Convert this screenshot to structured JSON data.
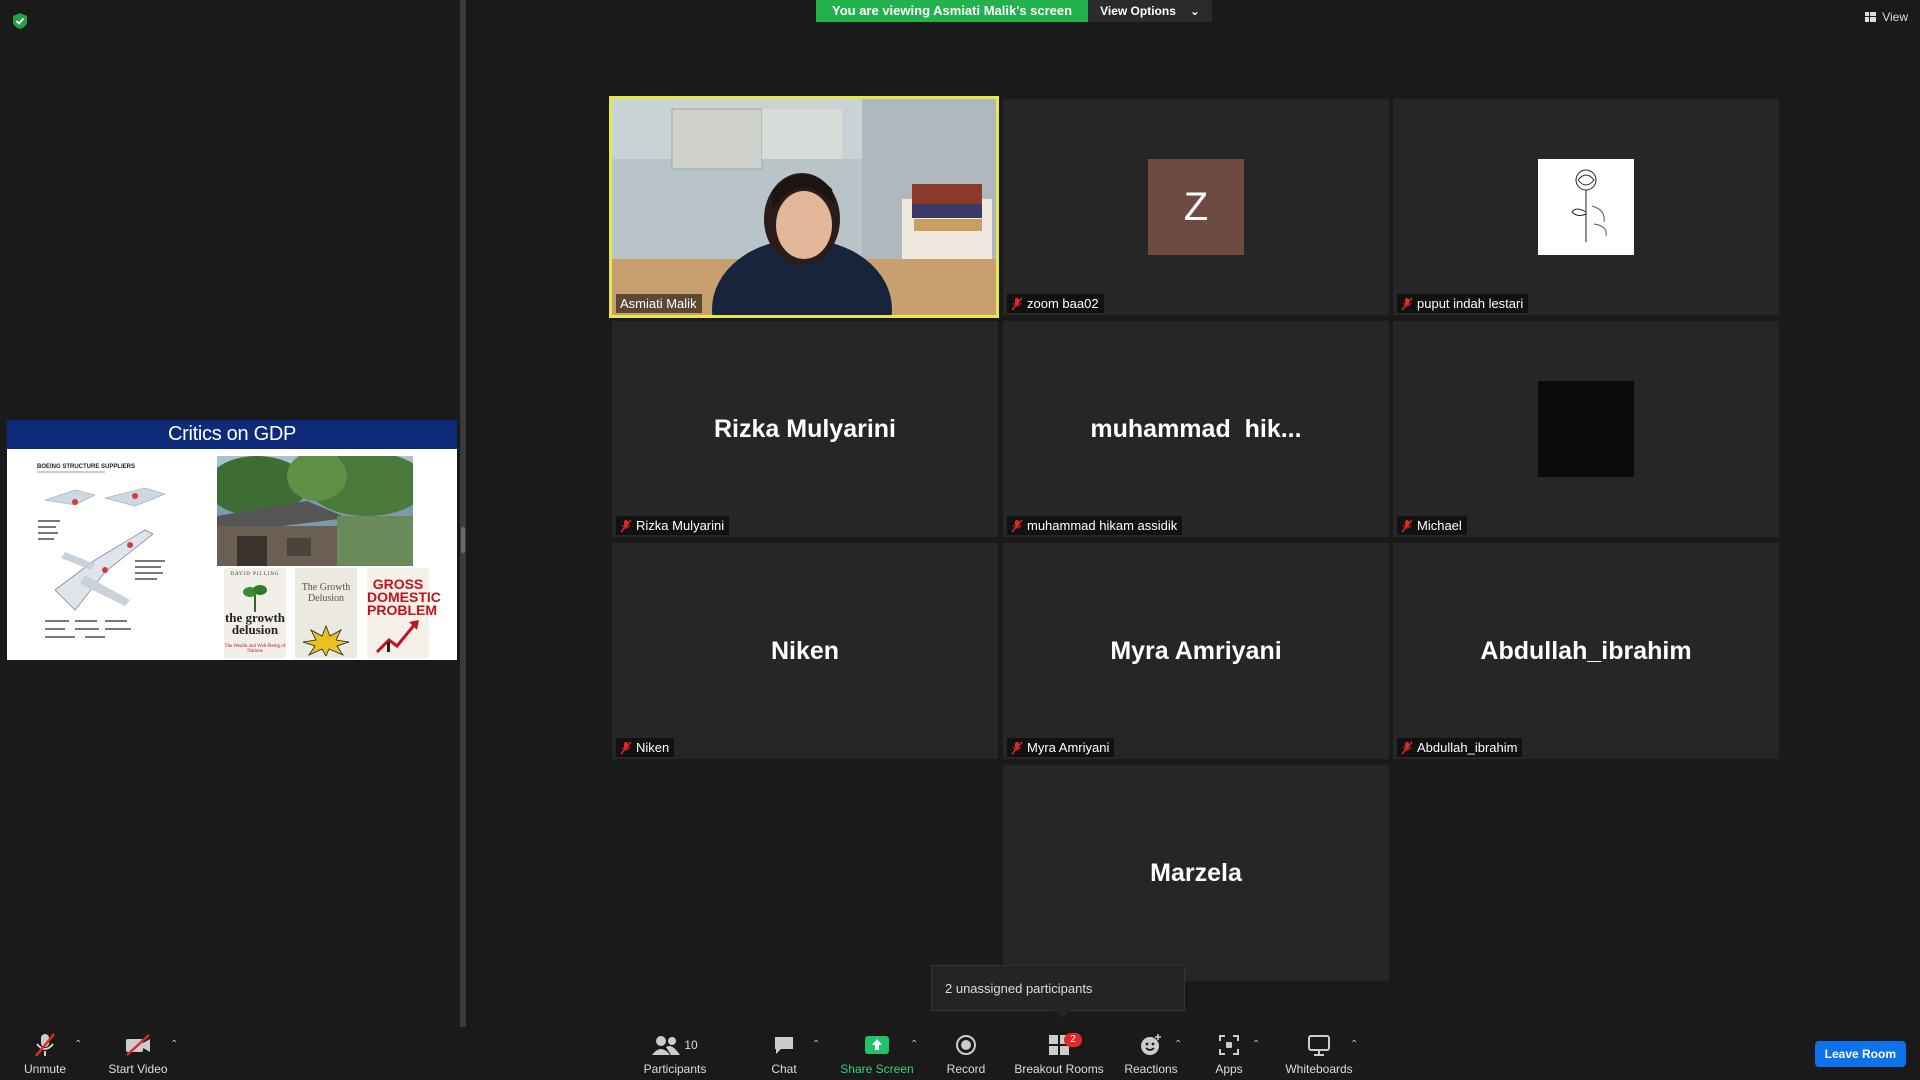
{
  "banner": {
    "viewing_text": "You are viewing Asmiati Malik's screen",
    "view_options": "View Options"
  },
  "view_button": "View",
  "shared_slide": {
    "title": "Critics on GDP",
    "diagram_heading": "BOEING STRUCTURE SUPPLIERS",
    "book1": {
      "author": "DAVID PILLING",
      "title": "the growth delusion",
      "subtitle": "The Wealth and Well-Being of Nations"
    },
    "book2": {
      "title": "The Growth Delusion"
    },
    "book3": {
      "title": "GROSS DOMESTIC PROBLEM"
    }
  },
  "participants": [
    {
      "name": "Asmiati Malik",
      "display": "",
      "video": true,
      "muted": false,
      "active": true
    },
    {
      "name": "zoom baa02",
      "display": "",
      "avatar_letter": "Z",
      "avatar_color": "#6e4a40",
      "muted": true
    },
    {
      "name": "puput indah lestari",
      "display": "",
      "avatar_image": "sketch",
      "muted": true
    },
    {
      "name": "Rizka Mulyarini",
      "display": "Rizka Mulyarini",
      "muted": true
    },
    {
      "name": "muhammad hikam assidik",
      "display": "muhammad  hik...",
      "muted": true
    },
    {
      "name": "Michael",
      "display": "",
      "avatar_image": "black",
      "muted": true
    },
    {
      "name": "Niken",
      "display": "Niken",
      "muted": true
    },
    {
      "name": "Myra Amriyani",
      "display": "Myra Amriyani",
      "muted": true
    },
    {
      "name": "Abdullah_ibrahim",
      "display": "Abdullah_ibrahim",
      "muted": true
    },
    {
      "name": "Marzela",
      "display": "Marzela",
      "muted": false,
      "label_hidden": true
    }
  ],
  "tooltip": "2 unassigned participants",
  "toolbar": {
    "unmute": "Unmute",
    "start_video": "Start Video",
    "participants": "Participants",
    "participants_count": "10",
    "chat": "Chat",
    "share_screen": "Share Screen",
    "record": "Record",
    "breakout_rooms": "Breakout Rooms",
    "breakout_badge": "2",
    "reactions": "Reactions",
    "apps": "Apps",
    "whiteboards": "Whiteboards",
    "leave_room": "Leave Room"
  },
  "colors": {
    "active_border": "#e6e64d",
    "banner_green": "#22b14c",
    "leave_blue": "#0e72ed",
    "mute_red": "#e02828"
  }
}
